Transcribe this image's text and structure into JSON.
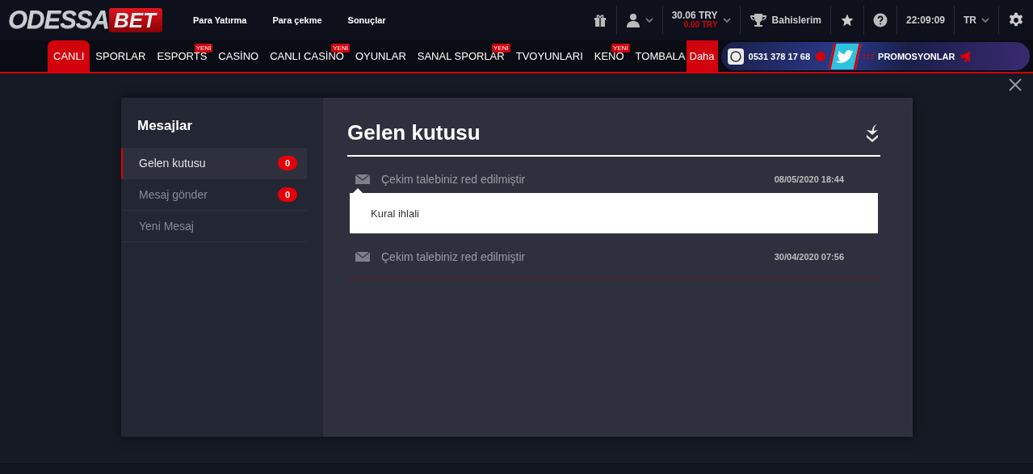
{
  "header": {
    "logo": {
      "word": "ODESSA",
      "accent": "BET"
    },
    "links": [
      "Para Yatırma",
      "Para çekme",
      "Sonuçlar"
    ],
    "balance": {
      "main": "30.06 TRY",
      "bonus": "0.00 TRY"
    },
    "bets_label": "Bahislerim",
    "clock": "22:09:09",
    "language": "TR"
  },
  "nav": {
    "items": [
      {
        "label": "CANLI",
        "selected": true
      },
      {
        "label": "SPORLAR",
        "selected": false
      },
      {
        "label": "ESPORTS",
        "selected": false,
        "badge": "YENİ"
      },
      {
        "label": "CASİNO",
        "selected": false
      },
      {
        "label": "CANLI CASİNO",
        "selected": false,
        "badge": "YENİ"
      },
      {
        "label": "OYUNLAR",
        "selected": false
      },
      {
        "label": "SANAL SPORLAR",
        "selected": false,
        "badge": "YENİ"
      },
      {
        "label": "TVOYUNLARI",
        "selected": false
      },
      {
        "label": "KENO",
        "selected": false,
        "badge": "YENİ"
      },
      {
        "label": "TOMBALA",
        "selected": false
      }
    ],
    "more": "Daha",
    "phone": "0531 378 17 68",
    "promo": "PROMOSYONLAR"
  },
  "modal": {
    "sidebar": {
      "title": "Mesajlar",
      "items": [
        {
          "label": "Gelen kutusu",
          "selected": true,
          "count": "0"
        },
        {
          "label": "Mesaj gönder",
          "selected": false,
          "count": "0"
        },
        {
          "label": "Yeni Mesaj",
          "selected": false
        }
      ]
    },
    "title": "Gelen kutusu",
    "messages": [
      {
        "subject": "Çekim talebiniz red edilmiştir",
        "date": "08/05/2020 18:44",
        "expanded": true,
        "body": "Kural ihlali"
      },
      {
        "subject": "Çekim talebiniz red edilmiştir",
        "date": "30/04/2020 07:56",
        "expanded": false
      }
    ]
  }
}
